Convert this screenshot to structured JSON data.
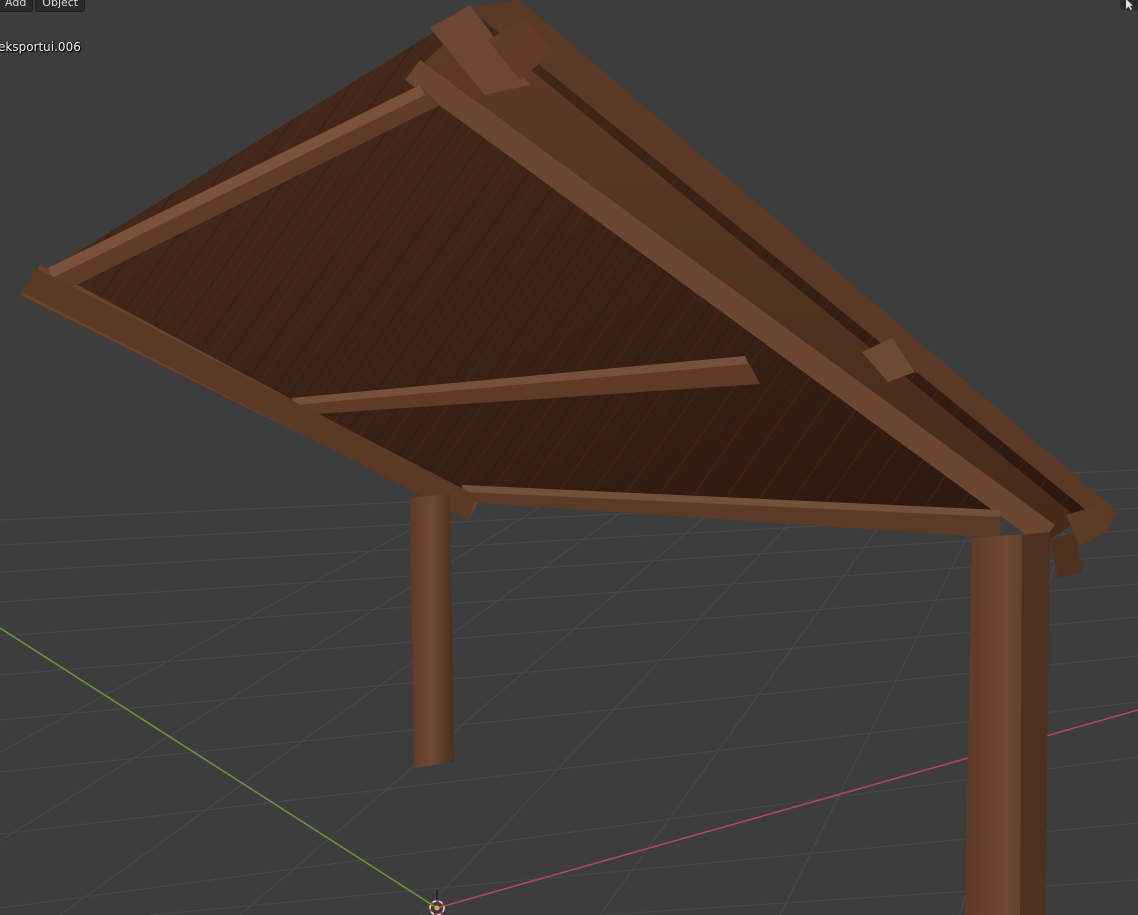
{
  "header": {
    "menus": [
      {
        "label": "Add"
      },
      {
        "label": "Object"
      }
    ]
  },
  "viewport": {
    "active_object_name": "eksportui.006",
    "axis_x_color": "#b04a55",
    "axis_y_color": "#6a9a3a",
    "grid_color": "#4a4a4a",
    "background_color": "#3d3d3d"
  },
  "icons": {
    "select_tool": "cursor-arrow-icon",
    "origin": "3d-cursor-icon"
  }
}
